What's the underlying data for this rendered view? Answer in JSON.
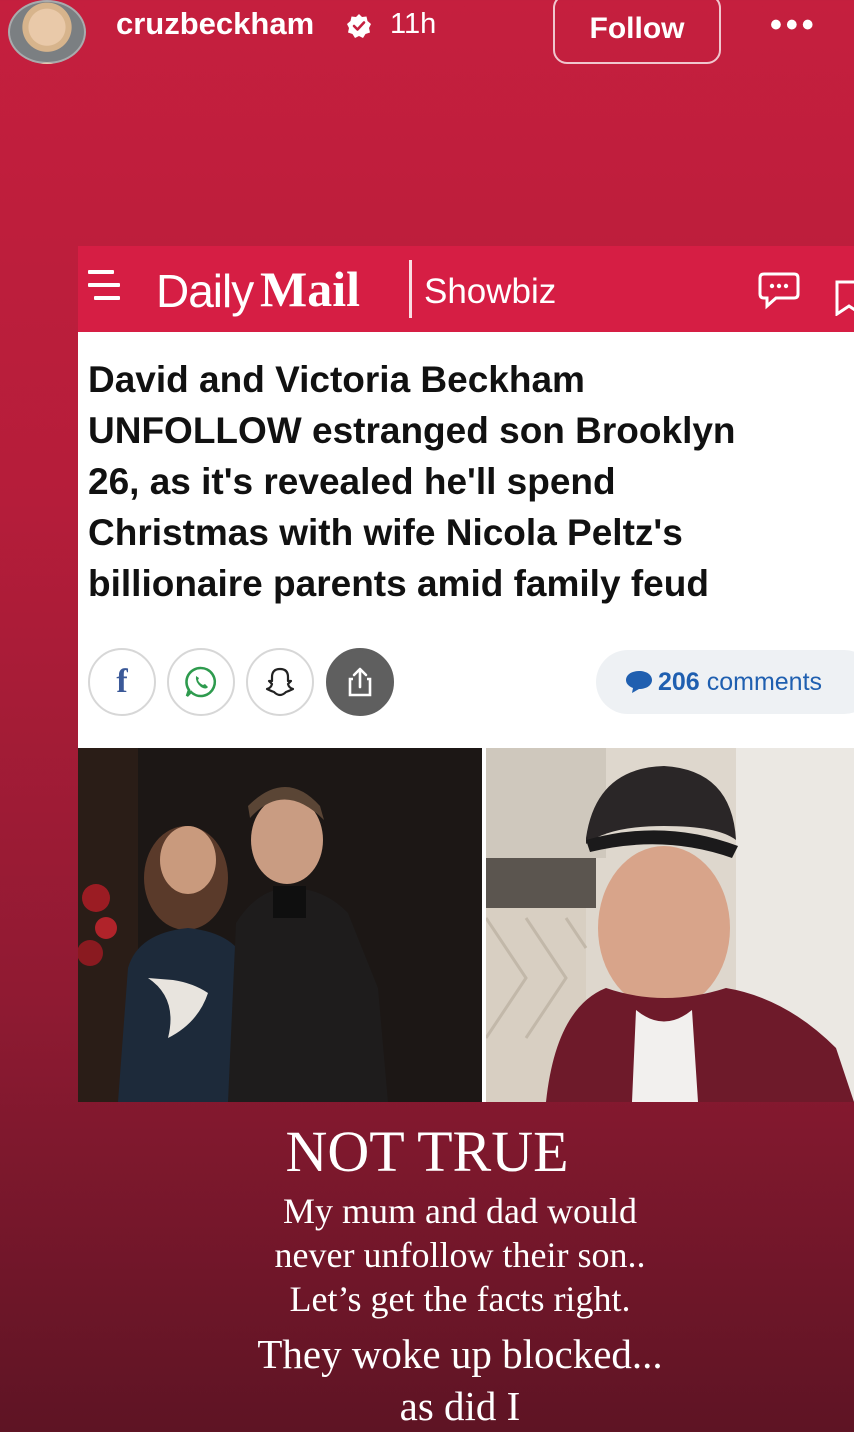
{
  "story": {
    "username": "cruzbeckham",
    "time_ago": "11h",
    "follow_label": "Follow",
    "more_label": "•••"
  },
  "article": {
    "brand_daily": "Daily",
    "brand_mail": "Mail",
    "section": "Showbiz",
    "headline_lines": [
      "David and Victoria Beckham",
      "UNFOLLOW estranged son Brooklyn",
      "26, as it's revealed he'll spend",
      "Christmas with wife Nicola Peltz's",
      "billionaire parents amid family feud"
    ],
    "comments_count": "206",
    "comments_label": "comments",
    "share_icons": [
      "facebook-icon",
      "whatsapp-icon",
      "snapchat-icon",
      "share-icon"
    ]
  },
  "caption": {
    "title": "NOT TRUE",
    "lines": [
      "My mum and dad would",
      "never unfollow their son..",
      "Let’s get the facts right.",
      "They woke up blocked...",
      "as did I"
    ]
  },
  "colors": {
    "story_bg_top": "#c51f3e",
    "story_bg_bottom": "#5e1424",
    "dailymail_red": "#d61e44",
    "comments_blue": "#1f5fb0"
  }
}
